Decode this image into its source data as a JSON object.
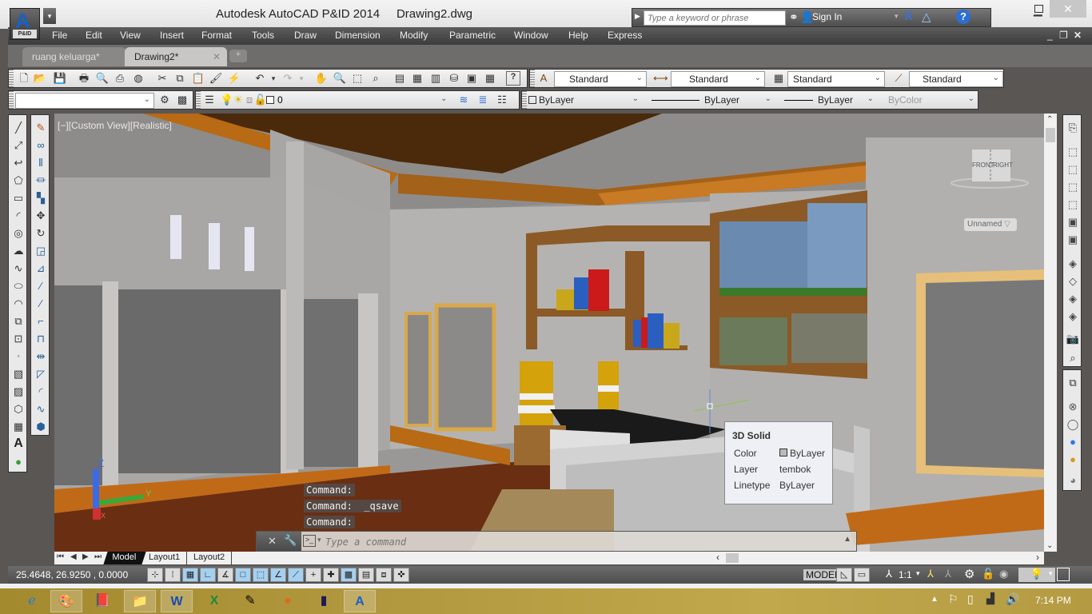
{
  "app": {
    "title": "Autodesk AutoCAD P&ID 2014     Drawing2.dwg",
    "app_badge": "P&ID",
    "app_letter": "A",
    "search_placeholder": "Type a keyword or phrase",
    "sign_in": "Sign In"
  },
  "menu": [
    "File",
    "Edit",
    "View",
    "Insert",
    "Format",
    "Tools",
    "Draw",
    "Dimension",
    "Modify",
    "Parametric",
    "Window",
    "Help",
    "Express"
  ],
  "file_tabs": [
    {
      "label": "ruang keluarga*",
      "active": false
    },
    {
      "label": "Drawing2*",
      "active": true
    }
  ],
  "toolbar": {
    "text_style": "Standard",
    "dim_style": "Standard",
    "table_style": "Standard",
    "mleader_style": "Standard",
    "workspace": "",
    "layer": "0",
    "color": "ByLayer",
    "linetype": "ByLayer",
    "lineweight": "ByLayer",
    "plotstyle": "ByColor"
  },
  "viewport": {
    "label": "[−][Custom View][Realistic]",
    "viewcube_front": "FRONT",
    "viewcube_right": "RIGHT",
    "ucs_named": "Unnamed",
    "axis_z": "Z",
    "axis_y": "Y",
    "axis_x": "X"
  },
  "tooltip": {
    "title": "3D Solid",
    "rows": [
      {
        "key": "Color",
        "value": "ByLayer"
      },
      {
        "key": "Layer",
        "value": "tembok"
      },
      {
        "key": "Linetype",
        "value": "ByLayer"
      }
    ]
  },
  "command": {
    "history": [
      "Command:",
      "Command:  _qsave",
      "Command:"
    ],
    "placeholder": "Type a command"
  },
  "layout_tabs": [
    "Model",
    "Layout1",
    "Layout2"
  ],
  "status": {
    "coords": "25.4648,  26.9250 , 0.0000",
    "space": "MODEL",
    "scale": "1:1"
  },
  "taskbar": {
    "time": "7:14 PM",
    "apps": [
      "internet-explorer",
      "paint",
      "book-app",
      "file-explorer",
      "word",
      "excel",
      "tool-app",
      "firefox",
      "media-app",
      "autocad"
    ]
  }
}
